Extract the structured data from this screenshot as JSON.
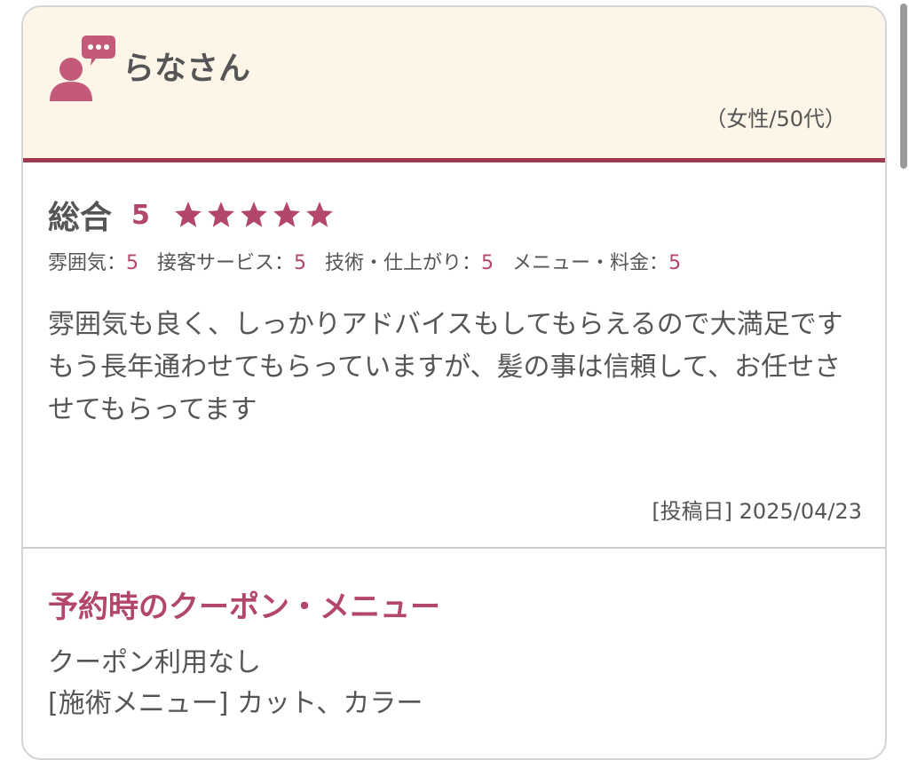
{
  "reviewer": {
    "name": "らなさん",
    "demographic": "（女性/50代）"
  },
  "rating": {
    "overall_label": "総合",
    "overall_score": "5",
    "stars": 5,
    "star_color": "#b3476a",
    "sub": [
      {
        "label": "雰囲気：",
        "value": "5"
      },
      {
        "label": "接客サービス：",
        "value": "5"
      },
      {
        "label": "技術・仕上がり：",
        "value": "5"
      },
      {
        "label": "メニュー・料金：",
        "value": "5"
      }
    ]
  },
  "review": {
    "paragraphs": [
      "雰囲気も良く、しっかりアドバイスもしてもらえるので大満足です",
      "もう長年通わせてもらっていますが、髪の事は信頼して、お任せさせてもらってます"
    ],
    "post_date": "[投稿日] 2025/04/23"
  },
  "coupon": {
    "title": "予約時のクーポン・メニュー",
    "coupon_line": "クーポン利用なし",
    "menu_line": "[施術メニュー] カット、カラー"
  },
  "colors": {
    "accent": "#b3476a",
    "header_bg": "#fdf6e8",
    "header_border": "#a03a4e",
    "text": "#555555"
  },
  "icons": {
    "user": "user-speech-bubble-icon",
    "star": "star-icon"
  }
}
